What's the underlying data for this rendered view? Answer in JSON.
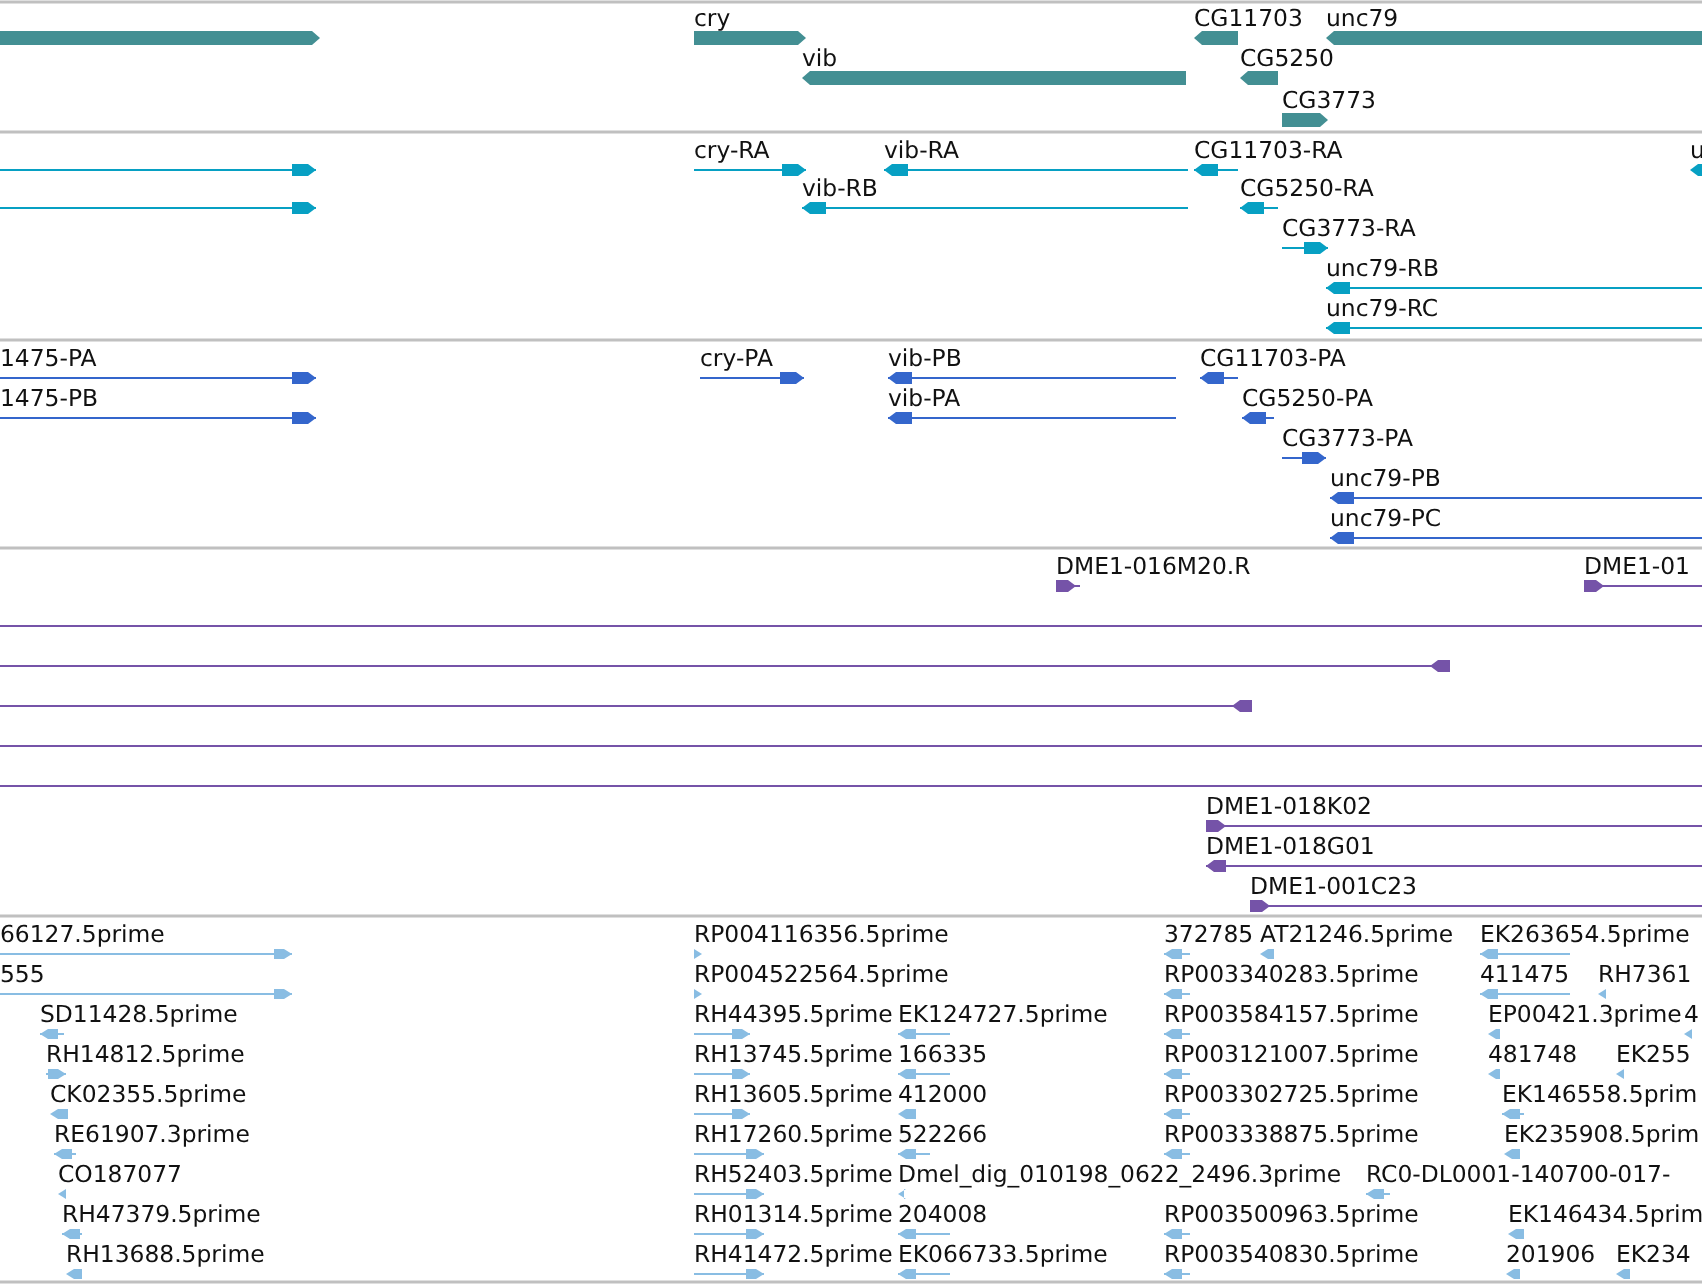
{
  "tracks": [
    {
      "kind": "gene",
      "features": [
        {
          "reverse": false
        },
        {
          "label": "cry",
          "reverse": false
        },
        {
          "label": "vib",
          "reverse": true
        },
        {
          "label": "CG11703",
          "reverse": true
        },
        {
          "label": "unc79",
          "reverse": true
        },
        {
          "label": "CG5250",
          "reverse": true
        },
        {
          "label": "CG3773",
          "reverse": false
        }
      ]
    },
    {
      "kind": "transcript",
      "features": [
        {
          "reverse": false
        },
        {
          "reverse": false
        },
        {
          "label": "cry-RA",
          "reverse": false
        },
        {
          "label": "vib-RA",
          "reverse": true
        },
        {
          "label": "vib-RB",
          "reverse": true
        },
        {
          "label": "CG11703-RA",
          "reverse": true
        },
        {
          "label": "CG5250-RA",
          "reverse": true
        },
        {
          "label": "CG3773-RA",
          "reverse": false
        },
        {
          "label": "unc79-RB",
          "reverse": true
        },
        {
          "label": "unc79-RC",
          "reverse": true
        },
        {
          "label": "u",
          "reverse": true
        }
      ]
    },
    {
      "kind": "protein",
      "features": [
        {
          "label": "1475-PA",
          "reverse": false
        },
        {
          "label": "1475-PB",
          "reverse": false
        },
        {
          "label": "cry-PA",
          "reverse": false
        },
        {
          "label": "vib-PB",
          "reverse": true
        },
        {
          "label": "vib-PA",
          "reverse": true
        },
        {
          "label": "CG11703-PA",
          "reverse": true
        },
        {
          "label": "CG5250-PA",
          "reverse": true
        },
        {
          "label": "CG3773-PA",
          "reverse": false
        },
        {
          "label": "unc79-PB",
          "reverse": true
        },
        {
          "label": "unc79-PC",
          "reverse": true
        }
      ]
    },
    {
      "kind": "clone",
      "features": [
        {
          "label": "DME1-016M20.R",
          "reverse": false
        },
        {
          "label": "DME1-01",
          "reverse": false
        },
        {
          "kind": "span"
        },
        {
          "reverse": true
        },
        {
          "reverse": true
        },
        {
          "kind": "span"
        },
        {
          "kind": "span"
        },
        {
          "label": "DME1-018K02",
          "reverse": false
        },
        {
          "label": "DME1-018G01",
          "reverse": true
        },
        {
          "label": "DME1-001C23",
          "reverse": false
        }
      ]
    },
    {
      "kind": "est",
      "features": [
        {
          "label": "66127.5prime",
          "reverse": false
        },
        {
          "label": "RP004116356.5prime",
          "reverse": false
        },
        {
          "label": "372785",
          "reverse": true
        },
        {
          "label": "AT21246.5prime",
          "reverse": true
        },
        {
          "label": "EK263654.5prime",
          "reverse": true
        },
        {
          "label": "555",
          "reverse": false
        },
        {
          "label": "RP004522564.5prime",
          "reverse": false
        },
        {
          "label": "RP003340283.5prime",
          "reverse": true
        },
        {
          "label": "411475",
          "reverse": true
        },
        {
          "label": "RH7361",
          "reverse": true
        },
        {
          "label": "SD11428.5prime",
          "reverse": true
        },
        {
          "label": "RH44395.5prime",
          "reverse": false
        },
        {
          "label": "EK124727.5prime",
          "reverse": true
        },
        {
          "label": "RP003584157.5prime",
          "reverse": true
        },
        {
          "label": "EP00421.3prime",
          "reverse": true
        },
        {
          "label": "4",
          "reverse": true
        },
        {
          "label": "RH14812.5prime",
          "reverse": false
        },
        {
          "label": "RH13745.5prime",
          "reverse": false
        },
        {
          "label": "166335",
          "reverse": true
        },
        {
          "label": "RP003121007.5prime",
          "reverse": true
        },
        {
          "label": "481748",
          "reverse": true
        },
        {
          "label": "EK255",
          "reverse": true
        },
        {
          "label": "CK02355.5prime",
          "reverse": true
        },
        {
          "label": "RH13605.5prime",
          "reverse": false
        },
        {
          "label": "412000",
          "reverse": true
        },
        {
          "label": "RP003302725.5prime",
          "reverse": true
        },
        {
          "label": "EK146558.5prim",
          "reverse": true
        },
        {
          "label": "RE61907.3prime",
          "reverse": true
        },
        {
          "label": "RH17260.5prime",
          "reverse": false
        },
        {
          "label": "522266",
          "reverse": true
        },
        {
          "label": "RP003338875.5prime",
          "reverse": true
        },
        {
          "label": "EK235908.5prim",
          "reverse": true
        },
        {
          "label": "CO187077",
          "reverse": true
        },
        {
          "label": "RH52403.5prime",
          "reverse": false
        },
        {
          "label": "Dmel_dig_010198_0622_2496.3prime",
          "reverse": true
        },
        {
          "label": "RC0-DL0001-140700-017-",
          "reverse": true
        },
        {
          "label": "RH47379.5prime",
          "reverse": true
        },
        {
          "label": "RH01314.5prime",
          "reverse": false
        },
        {
          "label": "204008",
          "reverse": true
        },
        {
          "label": "RP003500963.5prime",
          "reverse": true
        },
        {
          "label": "EK146434.5prim",
          "reverse": true
        },
        {
          "label": "RH13688.5prime",
          "reverse": true
        },
        {
          "label": "RH41472.5prime",
          "reverse": false
        },
        {
          "label": "EK066733.5prime",
          "reverse": true
        },
        {
          "label": "RP003540830.5prime",
          "reverse": true
        },
        {
          "label": "201906",
          "reverse": true
        },
        {
          "label": "EK234",
          "reverse": true
        }
      ]
    }
  ]
}
